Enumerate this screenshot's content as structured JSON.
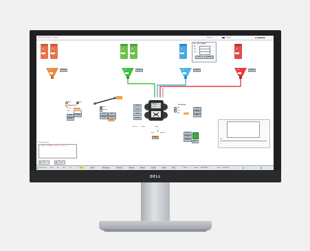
{
  "window": {
    "title": "Mixer HCT Plant 1.0 - Labeler",
    "brand": "LABBER",
    "language": "English",
    "zoom_label": "Zoom 1:1"
  },
  "monitor": {
    "brand": "DELL"
  },
  "hoppers": [
    {
      "label": "H1",
      "value": "660",
      "color": "#e8734a"
    },
    {
      "label": "H2",
      "value": "660",
      "color": "#e8734a"
    },
    {
      "label": "H3",
      "value": "660",
      "color": "#69c24a"
    },
    {
      "label": "H4",
      "value": "660",
      "color": "#69c24a"
    },
    {
      "label": "H5",
      "value": "660",
      "color": "#47a8e6"
    },
    {
      "label": "H6",
      "value": "660",
      "color": "#e24b4b"
    }
  ],
  "scales": [
    {
      "label": "W1",
      "value": "0.0",
      "button": "Weigh",
      "color": "#f08a3a"
    },
    {
      "label": "W2",
      "value": "0.0",
      "button": "Weigh",
      "color": "#3fc23f"
    },
    {
      "label": "W3",
      "value": "0.0",
      "button": "Weigh",
      "color": "#4ab4e6"
    },
    {
      "label": "W4",
      "value": "0.0",
      "button": "Weigh",
      "color": "#e83a3a"
    }
  ],
  "scale_panel": {
    "title": "B1 - M3 - MIXER",
    "rows": [
      "Act",
      "Set",
      "Tol"
    ],
    "ok": "Ok",
    "cancel": "Cancel"
  },
  "left_panel": {
    "title": "Manual Sel",
    "options": [
      "Auto",
      "Man"
    ],
    "fields": [
      "Speed",
      "Time"
    ],
    "buttons": [
      "Start",
      "Stop",
      "Reset"
    ]
  },
  "conveyor": {
    "buttons": [
      "Fwd",
      "Rev",
      "Stop",
      "Jog"
    ],
    "options": [
      "Auto",
      "Manual"
    ]
  },
  "mixer": {
    "label": "Mixer",
    "value": "0.00",
    "left_btns": [
      "Start",
      "Stop",
      "Hold",
      "Empty"
    ],
    "bottom": [
      "Speed",
      "0 rpm",
      "Temp"
    ],
    "status": [
      "Auto",
      "Manual"
    ],
    "bottom_btn": "Open"
  },
  "discharge_panel": {
    "title": "Discharge",
    "rows": [
      "Gate",
      "Valve",
      "Flap"
    ],
    "buttons": [
      "Open",
      "Close",
      "Auto"
    ]
  },
  "control_panel": {
    "buttons": [
      "Start",
      "Stop",
      "Reset",
      "Auto"
    ]
  },
  "chart_panel": {
    "values": [
      "100",
      "0"
    ]
  },
  "log": {
    "title": "Production Info",
    "lines": [
      "1 - MIXER - RUNNING - Production - Batch 4"
    ]
  },
  "actions": {
    "start": "Start",
    "cancel": "Cancel"
  },
  "status_bar": [
    "Production",
    "Auto",
    "B1",
    "660",
    "0.0",
    "Scale",
    "Mixer",
    "Discharge",
    "Cleaning",
    "Alarms",
    "Report",
    "Config",
    "Users",
    "Help"
  ],
  "footer_info": [
    {
      "label": "Batch",
      "value": "1"
    },
    {
      "label": "Recipe",
      "value": "MIXTURE A"
    },
    {
      "label": "Order",
      "value": "0000456"
    }
  ]
}
